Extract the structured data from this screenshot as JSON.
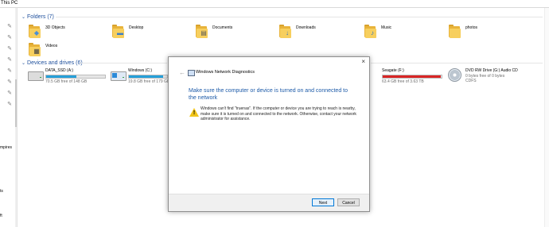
{
  "explorer": {
    "address": "This PC",
    "nav_fragments": [
      "mpires",
      "ts",
      "ft"
    ],
    "folders_header": "Folders (7)",
    "folders": [
      {
        "name": "3D Objects",
        "icon": "cube-icon"
      },
      {
        "name": "Desktop",
        "icon": "desktop-icon"
      },
      {
        "name": "Documents",
        "icon": "document-icon"
      },
      {
        "name": "Downloads",
        "icon": "download-arrow-icon"
      },
      {
        "name": "Music",
        "icon": "music-note-icon"
      },
      {
        "name": "photos",
        "icon": "folder-icon"
      },
      {
        "name": "Videos",
        "icon": "film-icon"
      }
    ],
    "drives_header": "Devices and drives (6)",
    "drives": [
      {
        "name": "DATA_SSD (A:)",
        "free": "70.5 GB free of 148 GB",
        "used_fraction": 0.52,
        "bar_color": "#26a0da"
      },
      {
        "name": "Windows (C:)",
        "free": "19.8 GB free of 179 GB",
        "used_fraction": 0.89,
        "bar_color": "#26a0da"
      },
      {
        "name": "Seagate (F:)",
        "free": "63.4 GB free of 3.63 TB",
        "used_fraction": 0.98,
        "bar_color": "#da2626"
      },
      {
        "name": "DVD RW Drive (G:) Audio CD",
        "free": "0 bytes free of 0 bytes",
        "fs": "CDFS"
      }
    ]
  },
  "dialog": {
    "title": "Windows Network Diagnostics",
    "heading": "Make sure the computer or device is turned on and connected to the network",
    "message": "Windows can't find \"truenas\". If the computer or device you are trying to reach is nearby, make sure it is turned on and connected to the network. Otherwise, contact your network administrator for assistance.",
    "next_label": "Next",
    "cancel_label": "Cancel",
    "close_glyph": "×",
    "back_glyph": "←"
  },
  "colors": {
    "accent_blue": "#1c5aa8",
    "folder_yellow": "#f7cf5e",
    "warning_yellow": "#f0c419",
    "drive_bar_blue": "#26a0da",
    "drive_bar_red": "#da2626"
  }
}
